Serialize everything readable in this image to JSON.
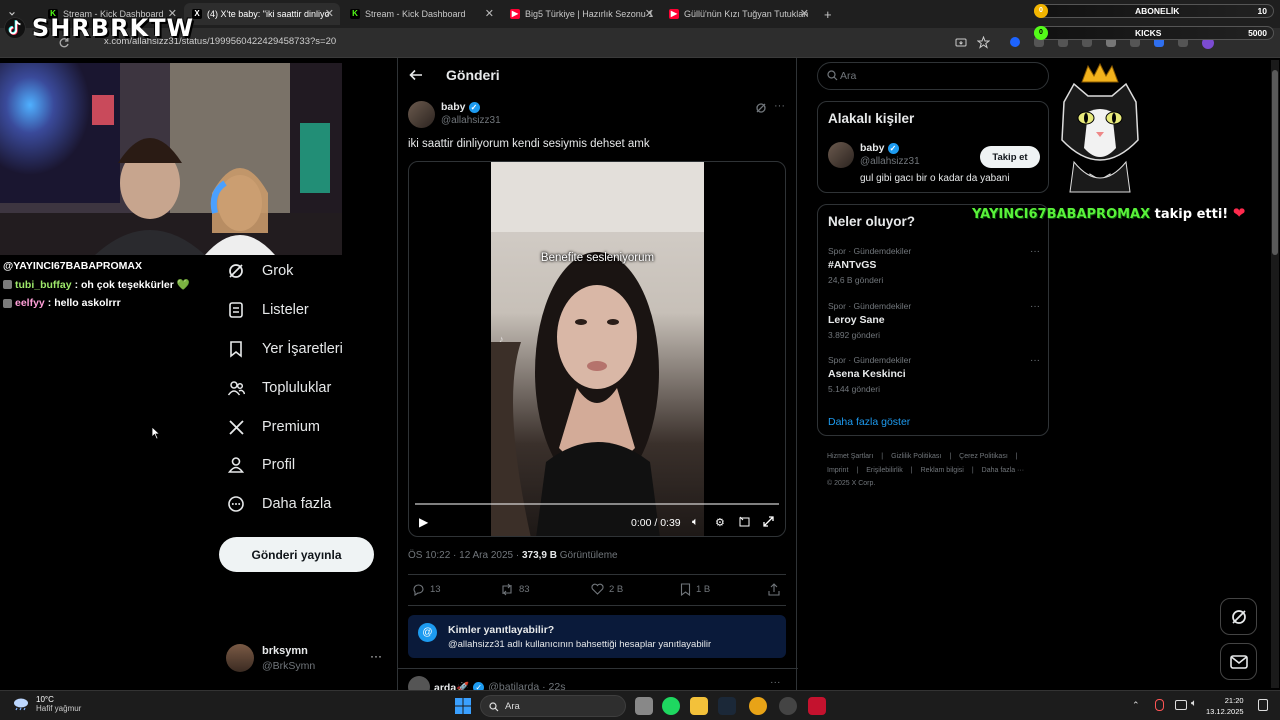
{
  "browser": {
    "tabs": [
      {
        "title": "Stream - Kick Dashboard",
        "icon": "kick",
        "active": false
      },
      {
        "title": "(4) X'te baby: \"iki saattir dinliyo",
        "icon": "x",
        "active": true
      },
      {
        "title": "Stream - Kick Dashboard",
        "icon": "kick",
        "active": false
      },
      {
        "title": "Big5 Türkiye | Hazırlık Sezonu 1",
        "icon": "youtube",
        "active": false
      },
      {
        "title": "Güllü'nün Kızı Tuğyan Tutuklan",
        "icon": "youtube",
        "active": false
      }
    ],
    "new_tab": "+",
    "url": "x.com/allahsizz31/status/1999560422429458733?s=20"
  },
  "overlay": {
    "streamer": "SHRBRKTW",
    "chat": [
      {
        "user": "@YAYINCI67BABAPROMAX",
        "msg": "",
        "user_color": "#ffffff"
      },
      {
        "user": "tubi_buffay",
        "msg": ": oh çok teşekkürler 💚",
        "user_color": "#9ee86a"
      },
      {
        "user": "eelfyy",
        "msg": ": hello askolrrr",
        "user_color": "#ff9fd8"
      }
    ],
    "subs": {
      "label": "ABONELİK",
      "value": "10",
      "badge": "0"
    },
    "kicks": {
      "label": "KICKS",
      "value": "5000",
      "badge": "0"
    },
    "follow_alert": {
      "name": "YAYINCI67BABAPROMAX",
      "text": "takip etti!",
      "heart": "❤"
    }
  },
  "nav": {
    "items": [
      {
        "label": "Grok",
        "icon": "grok-icon"
      },
      {
        "label": "Listeler",
        "icon": "list-icon"
      },
      {
        "label": "Yer İşaretleri",
        "icon": "bookmark-icon"
      },
      {
        "label": "Topluluklar",
        "icon": "communities-icon"
      },
      {
        "label": "Premium",
        "icon": "x-logo-icon"
      },
      {
        "label": "Profil",
        "icon": "profile-icon"
      },
      {
        "label": "Daha fazla",
        "icon": "more-circle-icon"
      }
    ],
    "post_button": "Gönderi yayınla",
    "account": {
      "name": "brksymn",
      "handle": "@BrkSymn",
      "more": "···"
    }
  },
  "post": {
    "header": "Gönderi",
    "author": {
      "name": "baby",
      "handle": "@allahsizz31"
    },
    "text": "iki saattir dinliyorum kendi sesiymis dehset amk",
    "video": {
      "caption": "Benefite sesleniyorum",
      "time": "0:00 / 0:39",
      "progress": 0
    },
    "meta": {
      "time": "ÖS 10:22 · 12 Ara 2025 · ",
      "views": "373,9 B",
      "views_label": " Görüntüleme"
    },
    "stats": {
      "replies": "13",
      "reposts": "83",
      "likes": "2 B",
      "bookmarks": "1 B"
    },
    "reply_notice": {
      "title": "Kimler yanıtlayabilir?",
      "desc": "@allahsizz31 adlı kullanıcının bahsettiği hesaplar yanıtlayabilir"
    },
    "next_reply": {
      "name": "arda🚀",
      "handle": "@batilarda · 22s"
    }
  },
  "sidebar": {
    "search_placeholder": "Ara",
    "related": {
      "title": "Alakalı kişiler",
      "name": "baby",
      "handle": "@allahsizz31",
      "bio": "gul gibi gacı bir o kadar da yabani",
      "follow": "Takip et"
    },
    "trends": {
      "title": "Neler oluyor?",
      "items": [
        {
          "category": "Spor · Gündemdekiler",
          "name": "#ANTvGS",
          "count": "24,6 B gönderi"
        },
        {
          "category": "Spor · Gündemdekiler",
          "name": "Leroy Sane",
          "count": "3.892 gönderi"
        },
        {
          "category": "Spor · Gündemdekiler",
          "name": "Asena Keskinci",
          "count": "5.144 gönderi"
        }
      ],
      "show_more": "Daha fazla göster"
    },
    "footer": {
      "links": [
        "Hizmet Şartları",
        "|",
        "Gizlilik Politikası",
        "|",
        "Çerez Politikası",
        "|",
        "Imprint",
        "|",
        "Erişilebilirlik",
        "|",
        "Reklam bilgisi",
        "|",
        "Daha fazla ···"
      ],
      "copyright": "© 2025 X Corp."
    }
  },
  "taskbar": {
    "weather": {
      "temp": "10°C",
      "desc": "Hafif yağmur"
    },
    "search": "Ara",
    "time": "21:20",
    "date": "13.12.2025"
  },
  "colors": {
    "accent": "#1d9bf0",
    "kick": "#53fc18",
    "background": "#000000",
    "follow_alert": "#59f23a"
  }
}
